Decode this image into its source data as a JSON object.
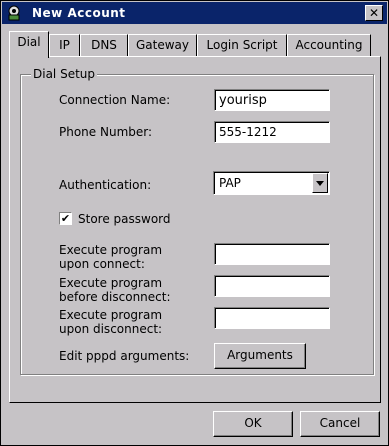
{
  "window": {
    "title": "New Account",
    "close_glyph": "✕"
  },
  "tabs": [
    {
      "label": "Dial",
      "active": true
    },
    {
      "label": "IP"
    },
    {
      "label": "DNS"
    },
    {
      "label": "Gateway"
    },
    {
      "label": "Login Script"
    },
    {
      "label": "Accounting"
    }
  ],
  "dial_setup": {
    "group_label": "Dial Setup",
    "connection_name": {
      "label": "Connection Name:",
      "value": "yourisp"
    },
    "phone_number": {
      "label": "Phone Number:",
      "value": "555-1212"
    },
    "authentication": {
      "label": "Authentication:",
      "value": "PAP"
    },
    "store_password": {
      "label": "Store password",
      "checked": true,
      "check_glyph": "✔"
    },
    "exec_connect": {
      "label_line1": "Execute program",
      "label_line2": "upon connect:",
      "value": ""
    },
    "exec_before_disconnect": {
      "label_line1": "Execute program",
      "label_line2": "before disconnect:",
      "value": ""
    },
    "exec_disconnect": {
      "label_line1": "Execute program",
      "label_line2": "upon disconnect:",
      "value": ""
    },
    "pppd_args": {
      "label": "Edit pppd arguments:",
      "button": "Arguments"
    }
  },
  "footer": {
    "ok": "OK",
    "cancel": "Cancel"
  },
  "colors": {
    "titlebar": "#0a246a",
    "face": "#c6c3c6"
  }
}
